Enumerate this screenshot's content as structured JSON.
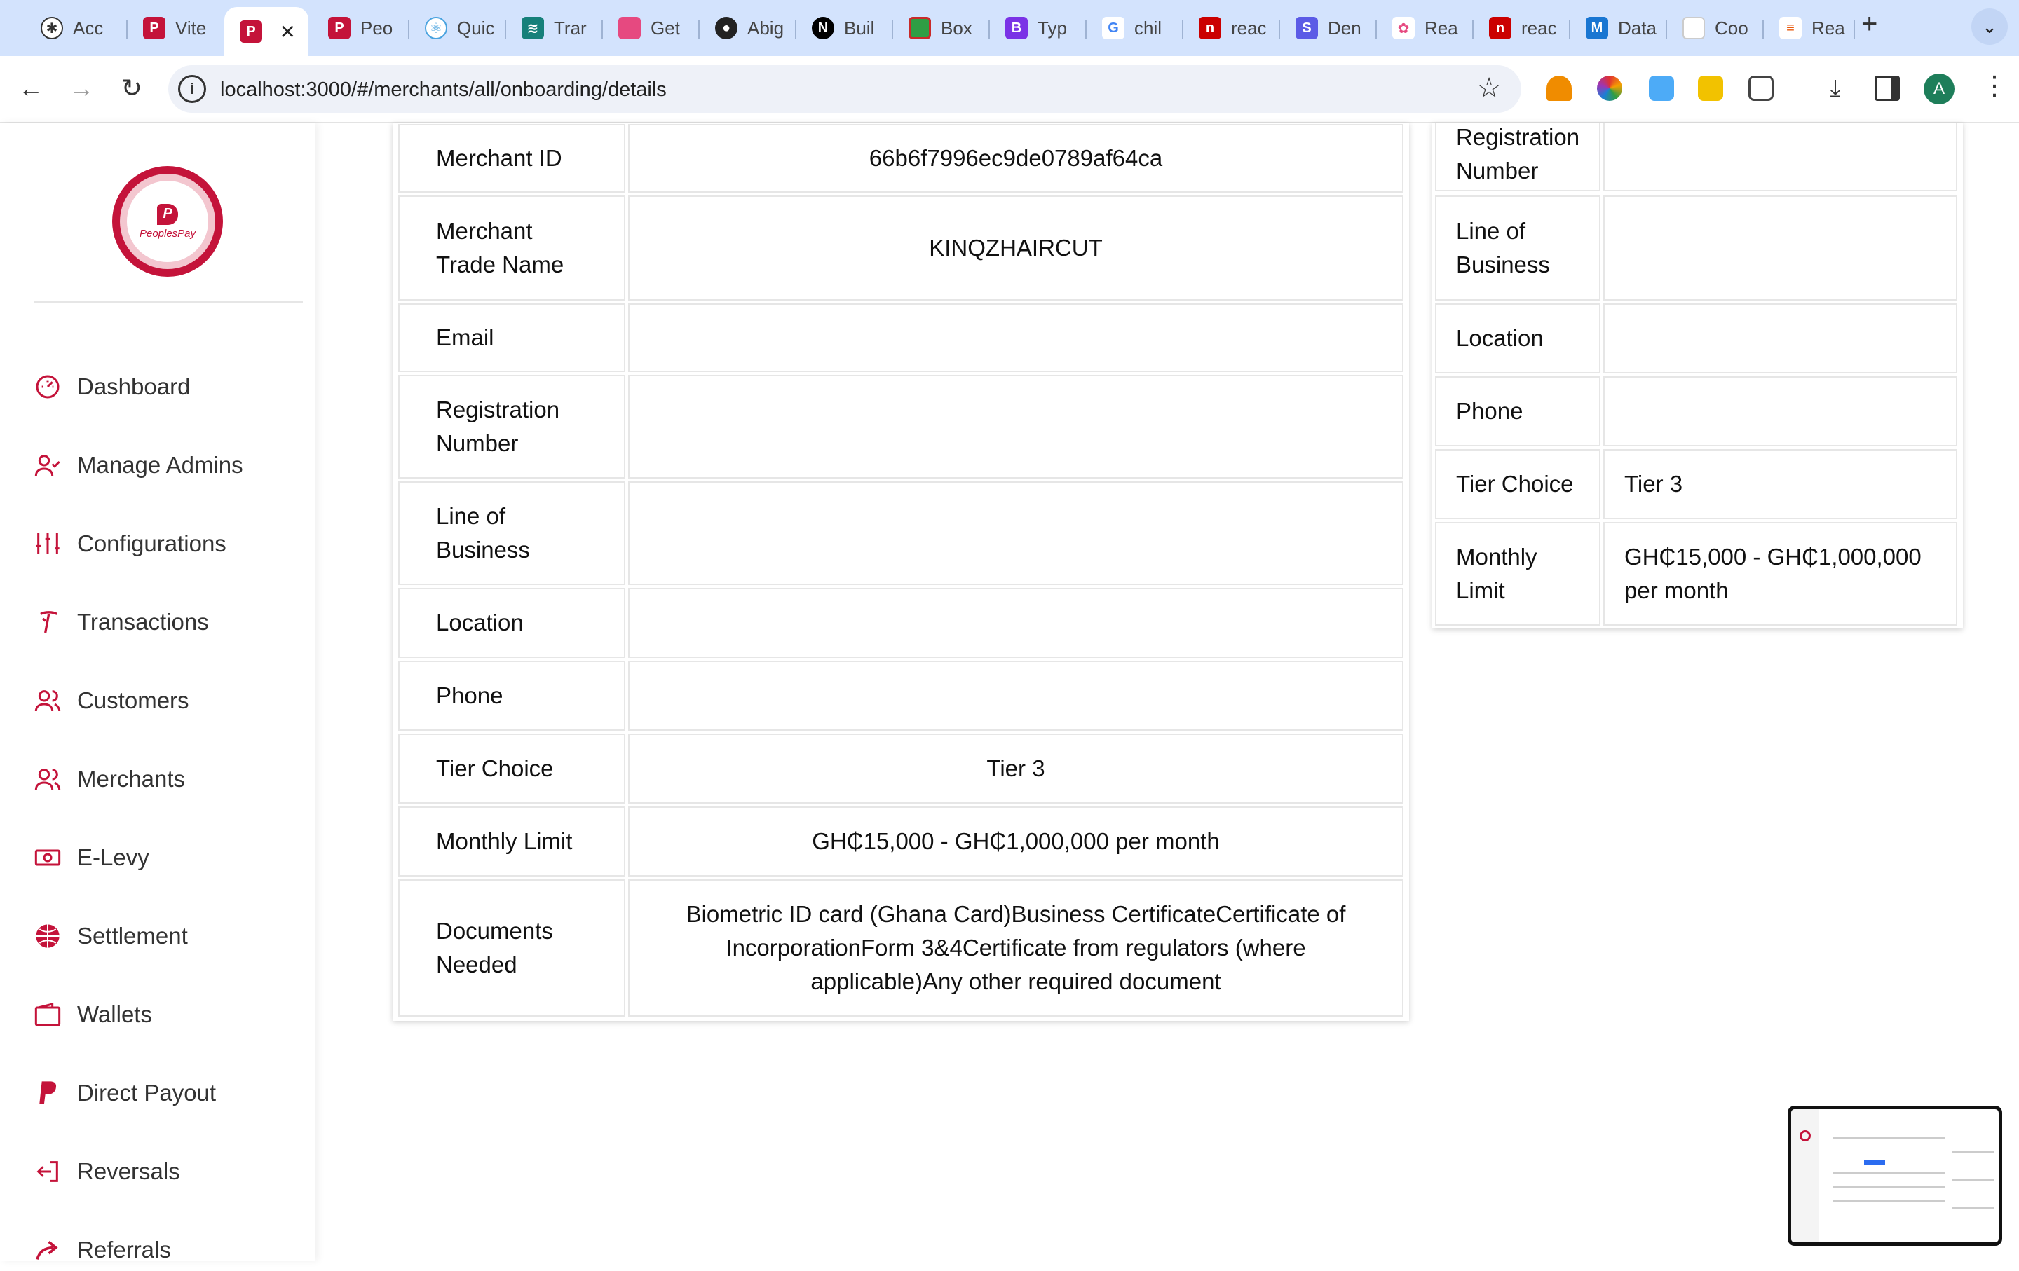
{
  "browser": {
    "tabs": [
      {
        "title": "Acc",
        "icon": "openai-icon",
        "color": "#333333"
      },
      {
        "title": "Vite",
        "icon": "peoplespay-icon",
        "color": "#c4133a"
      },
      {
        "title": "",
        "icon": "peoplespay-icon",
        "color": "#c4133a",
        "active": true
      },
      {
        "title": "Peo",
        "icon": "peoplespay-icon",
        "color": "#c4133a"
      },
      {
        "title": "Quic",
        "icon": "react-icon",
        "color": "#4aa3df"
      },
      {
        "title": "Trar",
        "icon": "tailwind-icon",
        "color": "#16807a"
      },
      {
        "title": "Get",
        "icon": "pink-square-icon",
        "color": "#e64980"
      },
      {
        "title": "Abig",
        "icon": "github-icon",
        "color": "#222222"
      },
      {
        "title": "Buil",
        "icon": "nextjs-icon",
        "color": "#000000"
      },
      {
        "title": "Box",
        "icon": "box-icon",
        "color": "#2f9e44"
      },
      {
        "title": "Typ",
        "icon": "bootstrap-icon",
        "color": "#7a32e6"
      },
      {
        "title": "chil",
        "icon": "google-icon",
        "color": "#4285f4"
      },
      {
        "title": "reac",
        "icon": "npm-icon",
        "color": "#cb0000"
      },
      {
        "title": "Den",
        "icon": "dev-icon",
        "color": "#5b5be6"
      },
      {
        "title": "Rea",
        "icon": "react-icon",
        "color": "#e64980"
      },
      {
        "title": "reac",
        "icon": "npm-icon",
        "color": "#cb0000"
      },
      {
        "title": "Data",
        "icon": "mui-icon",
        "color": "#1976d2"
      },
      {
        "title": "Coo",
        "icon": "blank-page-icon",
        "color": "#dddddd"
      },
      {
        "title": "Rea",
        "icon": "stripes-icon",
        "color": "#e8590c"
      }
    ],
    "url": "localhost:3000/#/merchants/all/onboarding/details",
    "profile_initial": "A"
  },
  "sidebar": {
    "brand": "PeoplesPay",
    "accent": "#c4133a",
    "items": [
      {
        "label": "Dashboard",
        "icon": "dashboard-icon"
      },
      {
        "label": "Manage Admins",
        "icon": "user-check-icon"
      },
      {
        "label": "Configurations",
        "icon": "sliders-icon"
      },
      {
        "label": "Transactions",
        "icon": "transactions-icon"
      },
      {
        "label": "Customers",
        "icon": "users-icon"
      },
      {
        "label": "Merchants",
        "icon": "users-icon"
      },
      {
        "label": "E-Levy",
        "icon": "banknote-icon"
      },
      {
        "label": "Settlement",
        "icon": "globe-icon"
      },
      {
        "label": "Wallets",
        "icon": "wallet-icon"
      },
      {
        "label": "Direct Payout",
        "icon": "paypal-icon"
      },
      {
        "label": "Reversals",
        "icon": "logout-icon"
      },
      {
        "label": "Referrals",
        "icon": "share-icon"
      }
    ]
  },
  "details": {
    "rows": [
      {
        "label": "Merchant ID",
        "value": "66b6f7996ec9de0789af64ca"
      },
      {
        "label": "Merchant Trade Name",
        "value": "KINQZHAIRCUT"
      },
      {
        "label": "Email",
        "value": ""
      },
      {
        "label": "Registration Number",
        "value": ""
      },
      {
        "label": "Line of Business",
        "value": ""
      },
      {
        "label": "Location",
        "value": ""
      },
      {
        "label": "Phone",
        "value": ""
      },
      {
        "label": "Tier Choice",
        "value": "Tier 3"
      },
      {
        "label": "Monthly Limit",
        "value": "GH₵15,000 - GH₵1,000,000 per month"
      },
      {
        "label": "Documents Needed",
        "value": "Biometric ID card (Ghana Card)Business CertificateCertificate of IncorporationForm 3&4Certificate from regulators (where applicable)Any other required document"
      }
    ]
  },
  "side_details": {
    "rows": [
      {
        "label": "Registration Number",
        "value": ""
      },
      {
        "label": "Line of Business",
        "value": ""
      },
      {
        "label": "Location",
        "value": ""
      },
      {
        "label": "Phone",
        "value": ""
      },
      {
        "label": "Tier Choice",
        "value": "Tier 3"
      },
      {
        "label": "Monthly Limit",
        "value": "GH₵15,000 - GH₵1,000,000 per month"
      }
    ]
  }
}
